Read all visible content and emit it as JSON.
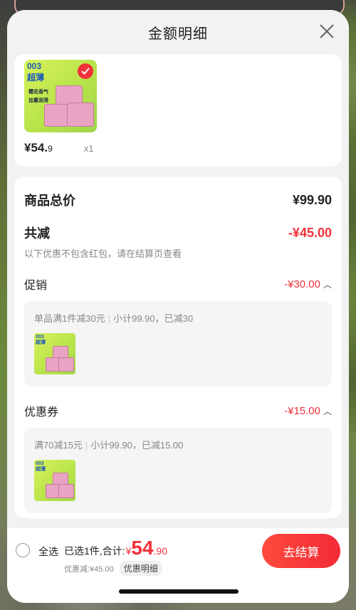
{
  "header": {
    "title": "金额明细"
  },
  "product": {
    "image_text_brand": "003",
    "image_text_sub": "超薄",
    "image_tag1": "樱花香气",
    "image_tag2": "加量润滑",
    "price_int": "¥54.",
    "price_dec": "9",
    "quantity": "x1"
  },
  "summary": {
    "total_label": "商品总价",
    "total_value": "¥99.90",
    "reduce_label": "共减",
    "reduce_value": "-¥45.00",
    "hint": "以下优惠不包含红包，请在结算页查看"
  },
  "promo": {
    "label": "促销",
    "value": "-¥30.00",
    "rule": "单品满1件减30元",
    "detail": "小计99.90，已减30"
  },
  "coupon": {
    "label": "优惠券",
    "value": "-¥15.00",
    "rule": "满70减15元",
    "detail": "小计99.90，已减15.00"
  },
  "footer": {
    "select_all": "全选",
    "selected_text": "已选1件,合计:",
    "currency": "¥",
    "total_int": "54",
    "total_dec": ".90",
    "discount_text": "优惠减:¥45.00",
    "discount_detail_button": "优惠明细",
    "checkout_button": "去结算"
  },
  "colors": {
    "accent": "#f2313a"
  },
  "icons": [
    "close-icon",
    "check-icon",
    "chevron-up-icon"
  ]
}
